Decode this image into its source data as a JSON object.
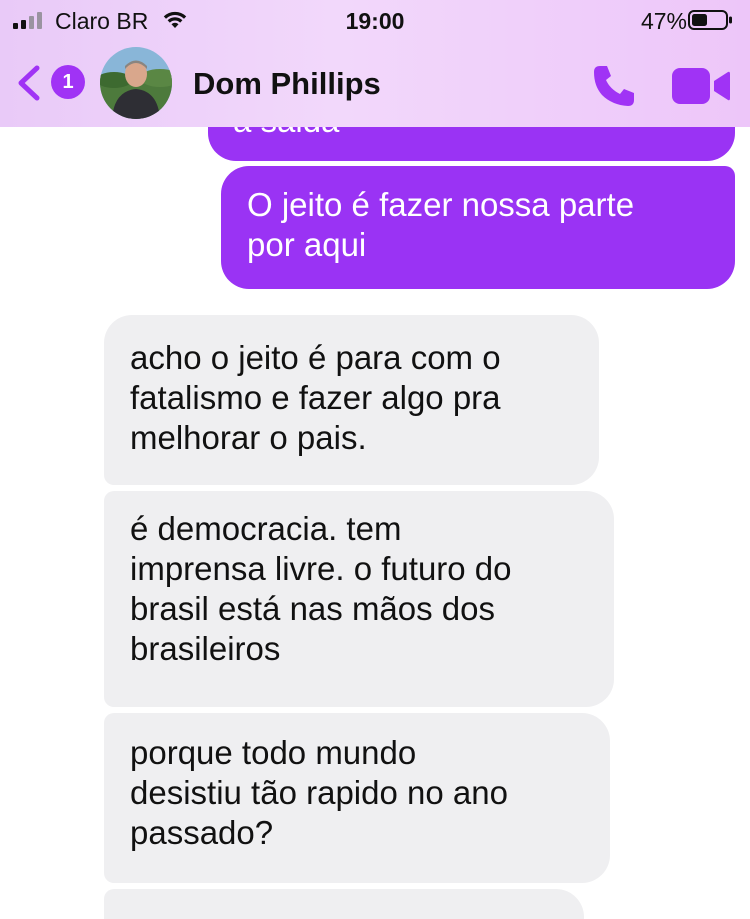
{
  "status_bar": {
    "carrier": "Claro BR",
    "time": "19:00",
    "battery_percent": "47%",
    "battery_level": 0.47
  },
  "header": {
    "back_count": "1",
    "contact_name": "Dom Phillips"
  },
  "icons": {
    "back": "chevron-left-icon",
    "call": "phone-icon",
    "video": "video-camera-icon",
    "wifi": "wifi-icon",
    "signal": "signal-icon",
    "battery": "battery-icon"
  },
  "colors": {
    "accent": "#9a33f4",
    "header_bg": "#efd2fa",
    "received_bubble": "#efeff1",
    "text": "#111111"
  },
  "messages": [
    {
      "direction": "sent",
      "text": "a saida"
    },
    {
      "direction": "sent",
      "text": "O jeito é fazer nossa parte\npor aqui"
    },
    {
      "direction": "received",
      "text": "acho o jeito é para com o\nfatalismo e fazer algo pra\nmelhorar o pais."
    },
    {
      "direction": "received",
      "text": "é democracia. tem\nimprensa livre. o futuro do\nbrasil está nas mãos dos\nbrasileiros"
    },
    {
      "direction": "received",
      "text": "porque todo mundo\ndesistiu tão rapido no ano\npassado?"
    }
  ]
}
